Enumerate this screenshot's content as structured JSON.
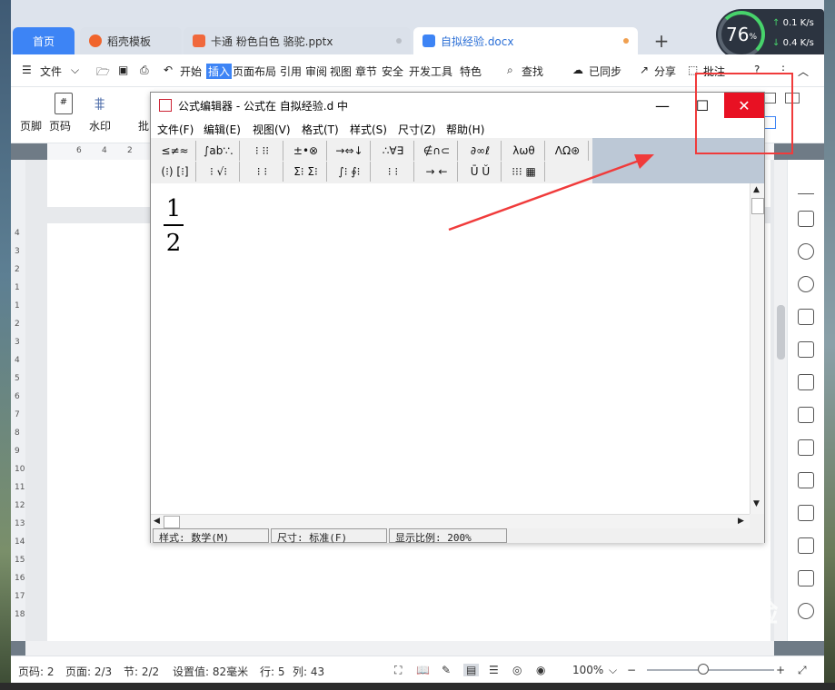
{
  "tabs": [
    {
      "label": "首页",
      "icon": "home-tab"
    },
    {
      "label": "稻壳模板",
      "icon": "docer-icon"
    },
    {
      "label": "卡通 粉色白色 骆驼.pptx",
      "icon": "ppt-file-icon"
    },
    {
      "label": "自拟经验.docx",
      "icon": "word-file-icon"
    }
  ],
  "speed": {
    "percent": "76",
    "unit": "%",
    "up": "0.1",
    "down": "0.4",
    "rate_unit": "K/s"
  },
  "menubar": {
    "file": "文件",
    "start": "开始",
    "insert": "插入",
    "layout": "页面布局",
    "reference": "引用",
    "review": "审阅",
    "view": "视图",
    "section": "章节",
    "security": "安全",
    "devtools": "开发工具",
    "special": "特色",
    "search": "查找",
    "sync": "已同步",
    "share": "分享",
    "comment": "批注",
    "help": "?"
  },
  "ribbon": {
    "footer": "页脚",
    "page_number": "页码",
    "watermark": "水印",
    "batch": "批"
  },
  "ruler": {
    "marks": [
      "6",
      "4",
      "2"
    ]
  },
  "vruler": {
    "marks": [
      "4",
      "3",
      "2",
      "1",
      "1",
      "2",
      "3",
      "4",
      "5",
      "6",
      "7",
      "8",
      "9",
      "10",
      "11",
      "12",
      "13",
      "14",
      "15",
      "16",
      "17",
      "18"
    ]
  },
  "eq_editor": {
    "title": "公式编辑器 - 公式在 自拟经验.d 中",
    "menu": [
      "文件(F)",
      "编辑(E)",
      "视图(V)",
      "格式(T)",
      "样式(S)",
      "尺寸(Z)",
      "帮助(H)"
    ],
    "toolbar_row1": [
      "≤≠≈",
      "∫ab∵.",
      "⁝ ⁝⁝",
      "±•⊗",
      "→⇔↓",
      "∴∀∃",
      "∉∩⊂",
      "∂∞ℓ",
      "λωθ",
      "ΛΩ⊛"
    ],
    "toolbar_row2": [
      "(⁝) [⁝]",
      "⁝ √⁝",
      "⁝ ⁝",
      "Σ⁝ Σ⁝",
      "∫⁝ ∮⁝",
      "⁝ ⁝",
      "→ ←",
      "Ū Ŭ",
      "⁝⁝⁝ ▦"
    ],
    "fraction": {
      "numerator": "1",
      "denominator": "2"
    },
    "status": {
      "style": "样式: 数学(M)",
      "size": "尺寸: 标准(F)",
      "zoom": "显示比例: 200%"
    }
  },
  "status_bar": {
    "page_code": "页码: 2",
    "pages": "页面: 2/3",
    "section": "节: 2/2",
    "setting": "设置值: 82毫米",
    "row": "行: 5",
    "col": "列: 43",
    "zoom": "100%"
  },
  "watermark": {
    "brand": "Baidu经验",
    "url": "jingyan.baidu.com"
  },
  "colors": {
    "accent": "#3d84f5",
    "close": "#e81123",
    "annotation": "#f03b3b"
  }
}
